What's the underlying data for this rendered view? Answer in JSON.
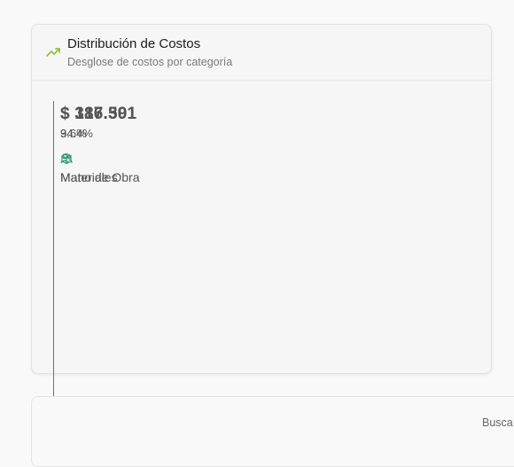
{
  "panel": {
    "title": "Distribución de Costos",
    "subtitle": "Desglose de costos por categoría",
    "icon": "trend-up-icon"
  },
  "categories": [
    {
      "amount": "$ 186.501",
      "percent": "3.6%",
      "label": "Materiales",
      "icon": "package-icon",
      "color": "#3fae49"
    },
    {
      "amount": "$ 317.391",
      "percent": "94.4%",
      "label": "Mano de Obra",
      "icon": "users-icon",
      "color": "#2f8d86"
    }
  ],
  "colors": {
    "accent": "#8cc63f",
    "line": "#3a8a7a"
  },
  "lower_panel": {
    "search_label": "Busca"
  }
}
